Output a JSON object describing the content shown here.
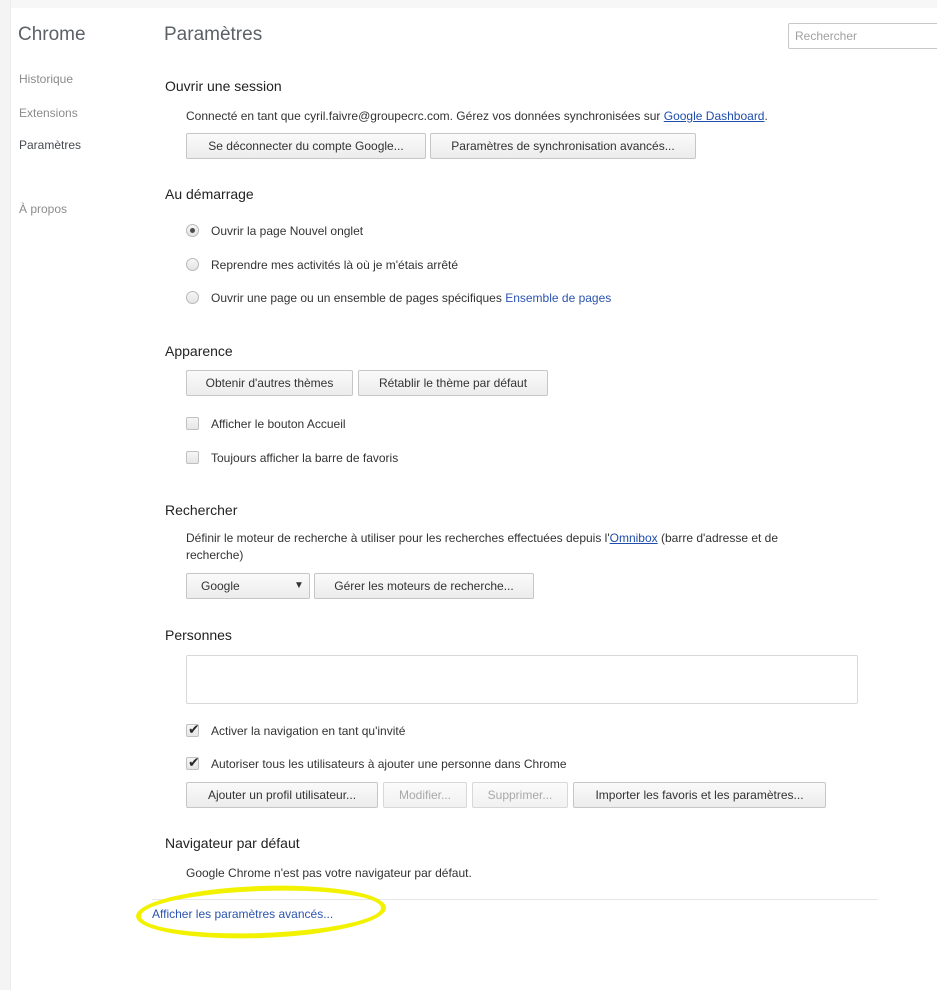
{
  "sidebar": {
    "brand": "Chrome",
    "items": [
      {
        "label": "Historique"
      },
      {
        "label": "Extensions"
      },
      {
        "label": "Paramètres"
      },
      {
        "label": "À propos"
      }
    ]
  },
  "header": {
    "title": "Paramètres",
    "search_placeholder": "Rechercher"
  },
  "signin": {
    "title": "Ouvrir une session",
    "text_prefix": "Connecté en tant que cyril.faivre@groupecrc.com. Gérez vos données synchronisées sur ",
    "dashboard_link": "Google Dashboard",
    "text_suffix": ".",
    "disconnect_button": "Se déconnecter du compte Google...",
    "sync_button": "Paramètres de synchronisation avancés..."
  },
  "startup": {
    "title": "Au démarrage",
    "options": [
      {
        "label": "Ouvrir la page Nouvel onglet",
        "checked": true
      },
      {
        "label": "Reprendre mes activités là où je m'étais arrêté",
        "checked": false
      },
      {
        "label": "Ouvrir une page ou un ensemble de pages spécifiques",
        "checked": false
      }
    ],
    "pages_link": "Ensemble de pages"
  },
  "appearance": {
    "title": "Apparence",
    "themes_button": "Obtenir d'autres thèmes",
    "reset_theme_button": "Rétablir le thème par défaut",
    "checkboxes": [
      {
        "label": "Afficher le bouton Accueil",
        "checked": false
      },
      {
        "label": "Toujours afficher la barre de favoris",
        "checked": false
      }
    ]
  },
  "search": {
    "title": "Rechercher",
    "desc_prefix": "Définir le moteur de recherche à utiliser pour les recherches effectuées depuis l'",
    "omnibox_link": "Omnibox",
    "desc_suffix_line1": " (barre d'adresse et de",
    "desc_line2": "recherche)",
    "engine_selected": "Google",
    "manage_button": "Gérer les moteurs de recherche..."
  },
  "people": {
    "title": "Personnes",
    "checkboxes": [
      {
        "label": "Activer la navigation en tant qu'invité",
        "checked": true
      },
      {
        "label": "Autoriser tous les utilisateurs à ajouter une personne dans Chrome",
        "checked": true
      }
    ],
    "add_button": "Ajouter un profil utilisateur...",
    "edit_button": "Modifier...",
    "delete_button": "Supprimer...",
    "import_button": "Importer les favoris et les paramètres..."
  },
  "default_browser": {
    "title": "Navigateur par défaut",
    "text": "Google Chrome n'est pas votre navigateur par défaut."
  },
  "advanced_link": "Afficher les paramètres avancés...",
  "colors": {
    "link": "#2b54b0",
    "highlight": "#f2f200"
  }
}
